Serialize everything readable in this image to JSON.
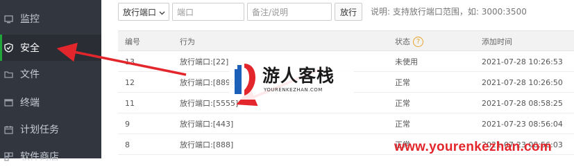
{
  "sidebar": {
    "items": [
      {
        "label": "监控",
        "icon": "monitor-icon"
      },
      {
        "label": "安全",
        "icon": "shield-icon",
        "active": true
      },
      {
        "label": "文件",
        "icon": "folder-icon"
      },
      {
        "label": "终端",
        "icon": "terminal-icon"
      },
      {
        "label": "计划任务",
        "icon": "calendar-icon"
      },
      {
        "label": "软件商店",
        "icon": "store-icon"
      }
    ]
  },
  "toolbar": {
    "select_value": "放行端口",
    "port_placeholder": "端口",
    "note_placeholder": "备注/说明",
    "submit_label": "放行",
    "hint": "说明: 支持放行端口范围，如: 3000:3500"
  },
  "table": {
    "headers": [
      "编号",
      "行为",
      "状态",
      "添加时间"
    ],
    "status_help": "?",
    "rows": [
      {
        "id": "13",
        "action": "放行端口:[22]",
        "status": "未使用",
        "time": "2021-07-28 10:26:53"
      },
      {
        "id": "12",
        "action": "放行端口:[8899]",
        "status": "正常",
        "time": "2021-07-28 10:26:50"
      },
      {
        "id": "11",
        "action": "放行端口:[5555]",
        "status": "正常",
        "time": "2021-07-28 08:58:25"
      },
      {
        "id": "9",
        "action": "放行端口:[443]",
        "status": "正常",
        "time": "2021-07-23 08:56:04"
      },
      {
        "id": "8",
        "action": "放行端口:[888]",
        "status": "正常",
        "time": "2021-07-23 08:56:03"
      }
    ]
  },
  "watermark": {
    "logo_title": "游人客栈",
    "logo_url": "YOURENKEZHAN.COM",
    "site_url": "www.yourenkezhan.com"
  },
  "colors": {
    "sidebar_bg": "#32363f",
    "active_accent": "#20a53a",
    "annotation_arrow": "#e3262c",
    "help_icon": "#e8a32a"
  }
}
